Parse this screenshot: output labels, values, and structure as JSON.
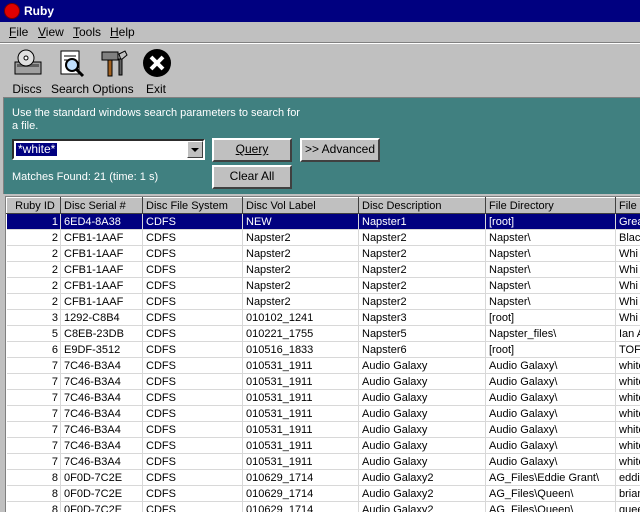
{
  "window": {
    "title": "Ruby"
  },
  "menu": [
    {
      "label": "File",
      "hotkey": "F",
      "rest": "ile"
    },
    {
      "label": "View",
      "hotkey": "V",
      "rest": "iew"
    },
    {
      "label": "Tools",
      "hotkey": "T",
      "rest": "ools"
    },
    {
      "label": "Help",
      "hotkey": "H",
      "rest": "elp"
    }
  ],
  "toolbar": {
    "discs": "Discs",
    "search": "Search",
    "options": "Options",
    "exit": "Exit"
  },
  "search": {
    "hint": "Use the standard windows search parameters to search for a file.",
    "query_value": "*white*",
    "query_button": "Query",
    "advanced_button": ">> Advanced",
    "clear_button": "Clear All",
    "matches": "Matches Found: 21 (time: 1 s)"
  },
  "table": {
    "columns": [
      "Ruby ID",
      "Disc Serial #",
      "Disc File System",
      "Disc Vol Label",
      "Disc Description",
      "File Directory",
      "File N"
    ],
    "rows": [
      [
        "1",
        "6ED4-8A38",
        "CDFS",
        "NEW",
        "Napster1",
        "[root]",
        "Grea"
      ],
      [
        "2",
        "CFB1-1AAF",
        "CDFS",
        "Napster2",
        "Napster2",
        "Napster\\",
        "Blac"
      ],
      [
        "2",
        "CFB1-1AAF",
        "CDFS",
        "Napster2",
        "Napster2",
        "Napster\\",
        "Whi"
      ],
      [
        "2",
        "CFB1-1AAF",
        "CDFS",
        "Napster2",
        "Napster2",
        "Napster\\",
        "Whi"
      ],
      [
        "2",
        "CFB1-1AAF",
        "CDFS",
        "Napster2",
        "Napster2",
        "Napster\\",
        "Whi"
      ],
      [
        "2",
        "CFB1-1AAF",
        "CDFS",
        "Napster2",
        "Napster2",
        "Napster\\",
        "Whi"
      ],
      [
        "3",
        "1292-C8B4",
        "CDFS",
        "010102_1241",
        "Napster3",
        "[root]",
        "Whi"
      ],
      [
        "5",
        "C8EB-23DB",
        "CDFS",
        "010221_1755",
        "Napster5",
        "Napster_files\\",
        "Ian A"
      ],
      [
        "6",
        "E9DF-3512",
        "CDFS",
        "010516_1833",
        "Napster6",
        "[root]",
        "TOF"
      ],
      [
        "7",
        "7C46-B3A4",
        "CDFS",
        "010531_1911",
        "Audio Galaxy",
        "Audio Galaxy\\",
        "white"
      ],
      [
        "7",
        "7C46-B3A4",
        "CDFS",
        "010531_1911",
        "Audio Galaxy",
        "Audio Galaxy\\",
        "white"
      ],
      [
        "7",
        "7C46-B3A4",
        "CDFS",
        "010531_1911",
        "Audio Galaxy",
        "Audio Galaxy\\",
        "white"
      ],
      [
        "7",
        "7C46-B3A4",
        "CDFS",
        "010531_1911",
        "Audio Galaxy",
        "Audio Galaxy\\",
        "white"
      ],
      [
        "7",
        "7C46-B3A4",
        "CDFS",
        "010531_1911",
        "Audio Galaxy",
        "Audio Galaxy\\",
        "white"
      ],
      [
        "7",
        "7C46-B3A4",
        "CDFS",
        "010531_1911",
        "Audio Galaxy",
        "Audio Galaxy\\",
        "white"
      ],
      [
        "7",
        "7C46-B3A4",
        "CDFS",
        "010531_1911",
        "Audio Galaxy",
        "Audio Galaxy\\",
        "white"
      ],
      [
        "8",
        "0F0D-7C2E",
        "CDFS",
        "010629_1714",
        "Audio Galaxy2",
        "AG_Files\\Eddie Grant\\",
        "eddi"
      ],
      [
        "8",
        "0F0D-7C2E",
        "CDFS",
        "010629_1714",
        "Audio Galaxy2",
        "AG_Files\\Queen\\",
        "brian"
      ],
      [
        "8",
        "0F0D-7C2E",
        "CDFS",
        "010629_1714",
        "Audio Galaxy2",
        "AG_Files\\Queen\\",
        "quee"
      ]
    ]
  },
  "colors": {
    "title_bar": "#000080",
    "panel": "#408080",
    "selection": "#000080"
  }
}
